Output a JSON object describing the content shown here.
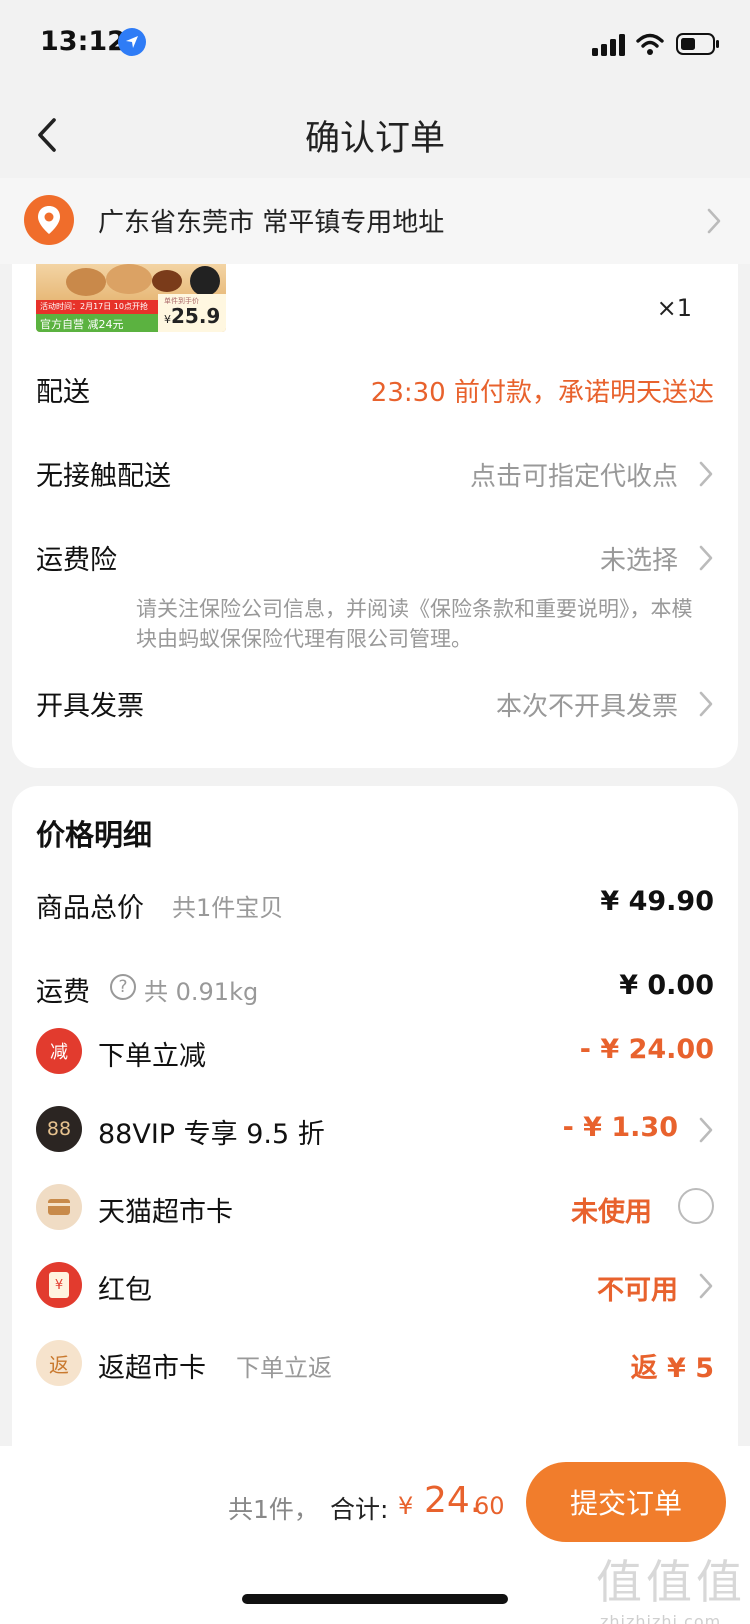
{
  "status_bar": {
    "time": "13:12"
  },
  "nav": {
    "title": "确认订单"
  },
  "address": {
    "text": "广东省东莞市 常平镇专用地址"
  },
  "product": {
    "promo_text": "活动时间：2月17日 10点开抢",
    "official_text": "官方自营 减24元",
    "price_label": "单件到手价",
    "price_yen": "¥",
    "price": "25.9",
    "quantity": "×1"
  },
  "order_rows": {
    "delivery": {
      "label": "配送",
      "value": "23:30 前付款，承诺明天送达"
    },
    "contactless": {
      "label": "无接触配送",
      "value": "点击可指定代收点"
    },
    "shipping_insurance": {
      "label": "运费险",
      "value": "未选择",
      "note": "请关注保险公司信息，并阅读《保险条款和重要说明》，本模块由蚂蚁保保险代理有限公司管理。"
    },
    "invoice": {
      "label": "开具发票",
      "value": "本次不开具发票"
    }
  },
  "price_detail": {
    "title": "价格明细",
    "goods_total": {
      "label": "商品总价",
      "sub": "共1件宝贝",
      "amount": "¥ 49.90"
    },
    "shipping_fee": {
      "label": "运费",
      "help": "?",
      "sub": "共 0.91kg",
      "amount": "¥ 0.00"
    },
    "order_discount": {
      "icon_text": "减",
      "label": "下单立减",
      "amount": "- ¥ 24.00"
    },
    "vip_discount": {
      "icon_text": "88",
      "label": "88VIP 专享 9.5 折",
      "amount": "- ¥ 1.30"
    },
    "market_card": {
      "label": "天猫超市卡",
      "value": "未使用"
    },
    "red_packet": {
      "icon_text": "¥",
      "label": "红包",
      "value": "不可用"
    },
    "cashback_card": {
      "icon_text": "返",
      "label": "返超市卡",
      "sub": "下单立返",
      "value": "返 ¥ 5"
    }
  },
  "bottom": {
    "count": "共1件，",
    "total_label": "合计:",
    "yen": "¥",
    "total_int": "24.",
    "total_dec": "60",
    "submit": "提交订单"
  },
  "watermark": {
    "glyphs": "值值值",
    "url": "zhizhizhi.com"
  },
  "colors": {
    "accent": "#e8622d",
    "submit_button": "#f17d2c",
    "location_blue": "#2f7cf6",
    "discount_red": "#e23b2e",
    "vip_dark": "#2b2522",
    "card_beige": "#f0dcc4"
  }
}
